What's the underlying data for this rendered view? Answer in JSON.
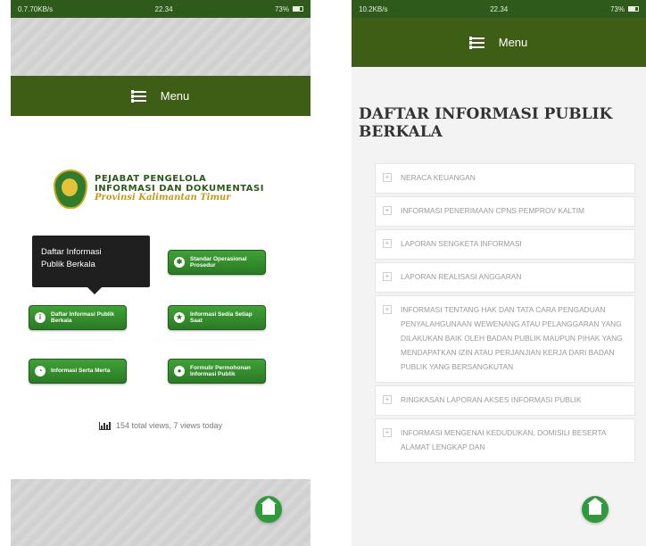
{
  "left": {
    "status": {
      "speed": "0.7.70KB/s",
      "time": "22.34",
      "battery": "73%"
    },
    "menu_label": "Menu",
    "logo": {
      "line1": "PEJABAT PENGELOLA",
      "line2": "INFORMASI DAN DOKUMENTASI",
      "line3": "Provinsi Kalimantan Timur"
    },
    "tooltip": {
      "line1": "Daftar Informasi",
      "line2": "Publik Berkala"
    },
    "buttons": [
      {
        "label": "Standar Operasional Prosedur",
        "icon": "gear-icon"
      },
      {
        "label": "Daftar Informasi Publik Berkala",
        "icon": "info-icon"
      },
      {
        "label": "Informasi Sedia Setiap Saat",
        "icon": "star-icon"
      },
      {
        "label": "Informasi Serta Merta",
        "icon": "clock-icon"
      },
      {
        "label": "Formulir Permohonan Informasi Publik",
        "icon": "chat-icon"
      }
    ],
    "views": "154 total views, 7 views today"
  },
  "right": {
    "status": {
      "speed": "10.2KB/s",
      "time": "22.34",
      "battery": "73%"
    },
    "menu_label": "Menu",
    "title": "DAFTAR INFORMASI PUBLIK BERKALA",
    "items": [
      "NERACA KEUANGAN",
      "INFORMASI PENERIMAAN CPNS PEMPROV KALTIM",
      "LAPORAN SENGKETA INFORMASI",
      "LAPORAN REALISASI ANGGARAN",
      "INFORMASI TENTANG HAK DAN TATA CARA PENGADUAN PENYALAHGUNAAN WEWENANG ATAU PELANGGARAN YANG DILAKUKAN BAIK OLEH BADAN PUBLIK MAUPUN PIHAK YANG MENDAPATKAN IZIN ATAU PERJANJIAN KERJA DARI BADAN PUBLIK YANG BERSANGKUTAN",
      "RINGKASAN LAPORAN AKSES INFORMASI PUBLIK",
      "INFORMASI MENGENAI KEDUDUKAN, DOMISILI BESERTA ALAMAT LENGKAP DAN"
    ]
  },
  "colors": {
    "menu_bg": "#3e5e16",
    "status_bg": "#2e5b1c",
    "button_green": "#2f8a2a"
  }
}
